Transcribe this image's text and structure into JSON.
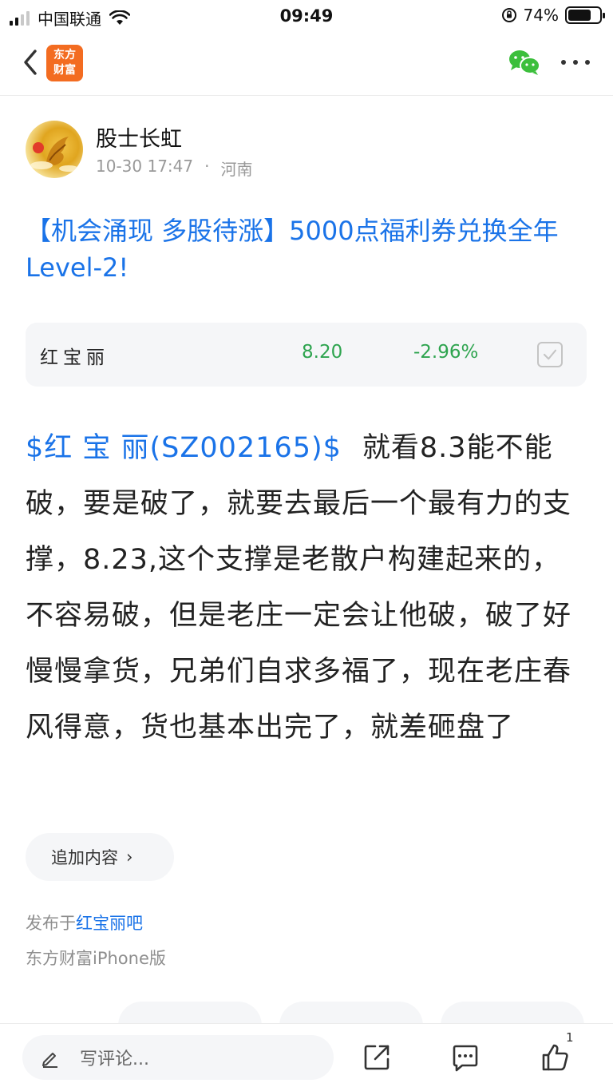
{
  "status_bar": {
    "carrier": "中国联通",
    "time": "09:49",
    "battery_percent": "74%",
    "battery_level": 0.74
  },
  "nav": {
    "logo_line1": "东方",
    "logo_line2": "财富",
    "back_icon": "chevron-left-icon",
    "share_icon": "wechat-icon",
    "more_icon": "more-dots-icon"
  },
  "author": {
    "name": "股士长虹",
    "time": "10-30 17:47",
    "separator": "·",
    "location": "河南"
  },
  "post": {
    "title": "【机会涌现 多股待涨】5000点福利券兑换全年Level-2!",
    "stock_tag": "$红 宝 丽(SZ002165)$",
    "body_text": "就看8.3能不能破，要是破了，就要去最后一个最有力的支撑，8.23,这个支撑是老散户构建起来的，不容易破，但是老庄一定会让他破，破了好慢慢拿货，兄弟们自求多福了，现在老庄春风得意，货也基本出完了，就差砸盘了"
  },
  "stock_card": {
    "name": "红宝丽",
    "price": "8.20",
    "change": "-2.96%",
    "change_color": "#2ea44f"
  },
  "append": {
    "label": "追加内容",
    "chevron": "›"
  },
  "footer": {
    "published_prefix": "发布于",
    "bar_name": "红宝丽吧",
    "client": "东方财富iPhone版"
  },
  "bottom_bar": {
    "comment_placeholder": "写评论...",
    "like_count": "1"
  },
  "colors": {
    "link_blue": "#1a73e8",
    "brand_orange": "#f36c21",
    "down_green": "#2ea44f"
  }
}
